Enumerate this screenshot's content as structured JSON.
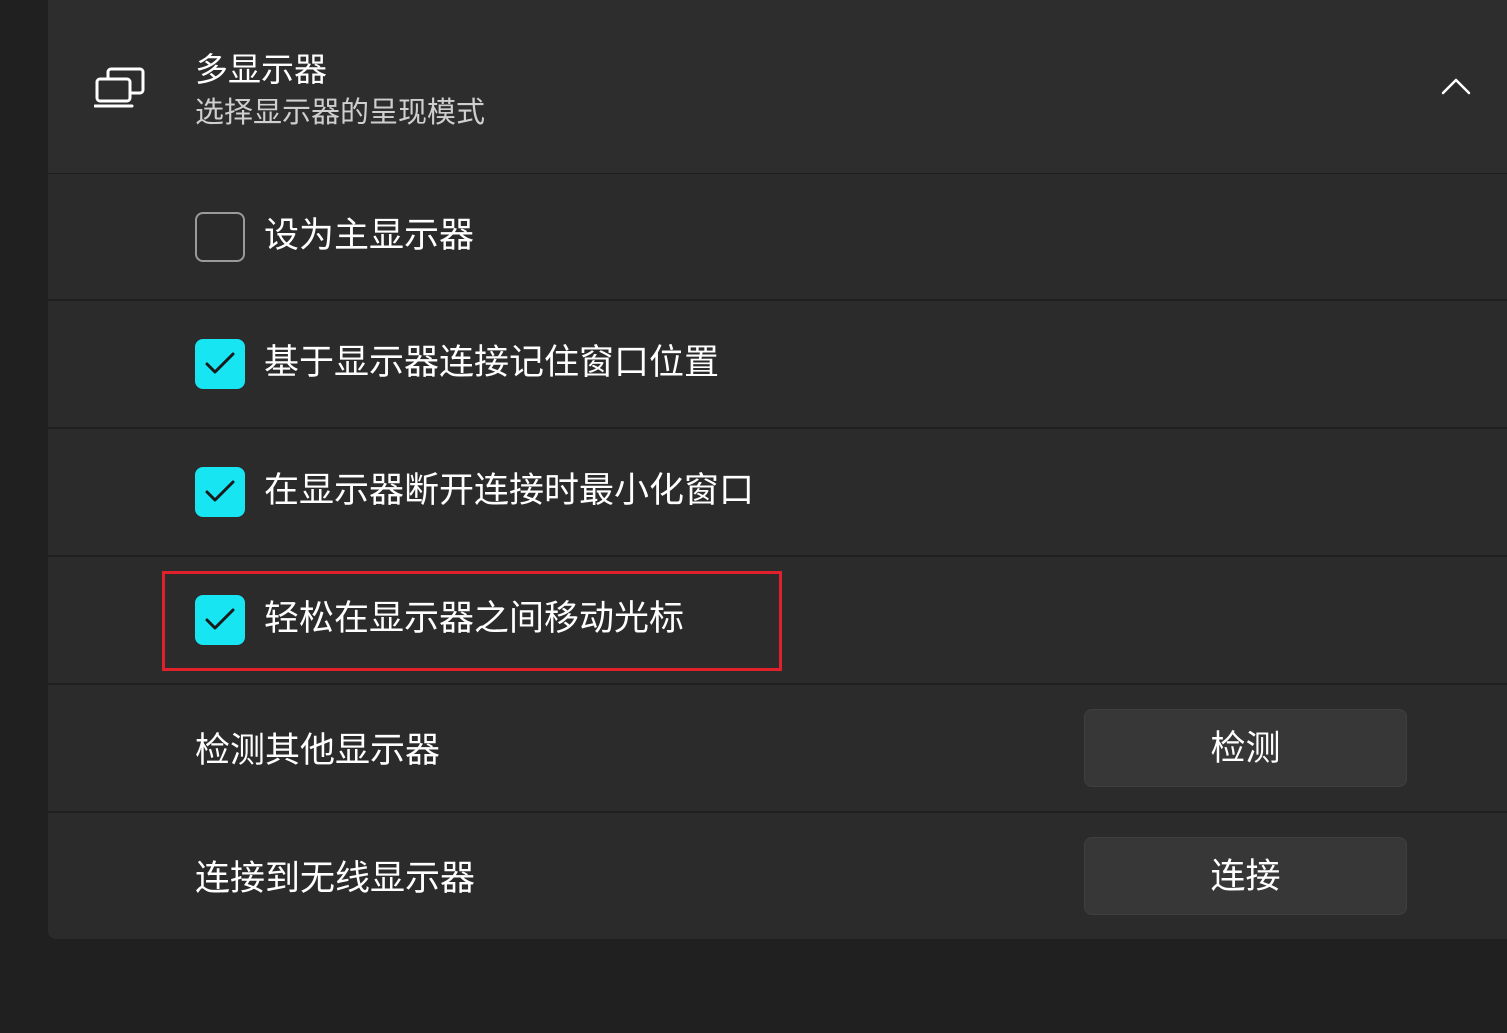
{
  "header": {
    "title": "多显示器",
    "subtitle": "选择显示器的呈现模式",
    "icon": "multi-monitor-icon",
    "expand_icon": "chevron-up-icon",
    "expanded": true
  },
  "options": [
    {
      "label": "设为主显示器",
      "checked": false
    },
    {
      "label": "基于显示器连接记住窗口位置",
      "checked": true
    },
    {
      "label": "在显示器断开连接时最小化窗口",
      "checked": true
    },
    {
      "label": "轻松在显示器之间移动光标",
      "checked": true,
      "highlighted": true
    }
  ],
  "actions": [
    {
      "label": "检测其他显示器",
      "button": "检测"
    },
    {
      "label": "连接到无线显示器",
      "button": "连接"
    }
  ],
  "colors": {
    "accent": "#17e6f2",
    "highlight_border": "#e0202a",
    "background": "#202020",
    "card": "#2b2b2b"
  }
}
